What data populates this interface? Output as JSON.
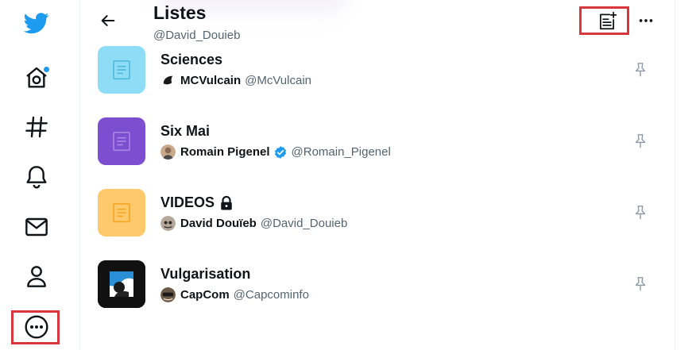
{
  "header": {
    "title": "Listes",
    "handle": "@David_Douieb"
  },
  "colors": {
    "twitter_blue": "#1d9bf0",
    "highlight_red": "#d9363e",
    "text_primary": "#0f1419",
    "text_secondary": "#536471"
  },
  "sidebar": {
    "items": [
      {
        "icon": "twitter-logo-icon"
      },
      {
        "icon": "home-icon",
        "has_notification_dot": true
      },
      {
        "icon": "hashtag-icon"
      },
      {
        "icon": "bell-icon"
      },
      {
        "icon": "mail-icon"
      },
      {
        "icon": "profile-icon"
      },
      {
        "icon": "more-circle-icon",
        "highlighted": true
      }
    ]
  },
  "toolbar": {
    "new_list_icon": "new-list-icon",
    "new_list_highlighted": true,
    "more_icon": "more-horizontal-icon"
  },
  "lists": [
    {
      "name": "Sciences",
      "private": false,
      "owner_name": "MCVulcain",
      "owner_handle": "@McVulcain",
      "verified": false,
      "thumb_color": "#8fdcf7",
      "pinned": false
    },
    {
      "name": "Six Mai",
      "private": false,
      "owner_name": "Romain Pigenel",
      "owner_handle": "@Romain_Pigenel",
      "verified": true,
      "thumb_color": "#7d4fd0",
      "pinned": false
    },
    {
      "name": "VIDEOS",
      "private": true,
      "owner_name": "David Douïeb",
      "owner_handle": "@David_Douieb",
      "verified": false,
      "thumb_color": "#fdc96a",
      "pinned": false
    },
    {
      "name": "Vulgarisation",
      "private": false,
      "owner_name": "CapCom",
      "owner_handle": "@Capcominfo",
      "verified": false,
      "thumb_color": "#0f1419",
      "pinned": false
    }
  ]
}
